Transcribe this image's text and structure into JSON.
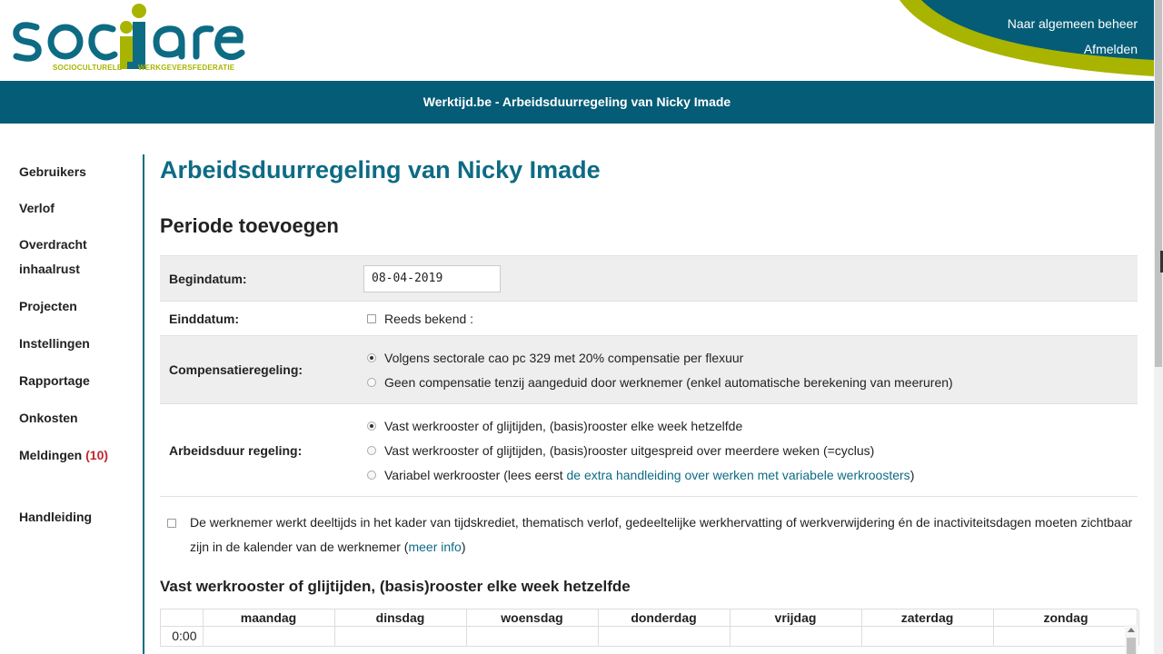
{
  "header": {
    "logo_word": "socmare",
    "logo_tag_left": "SOCIOCULTURELE",
    "logo_tag_right": "WERKGEVERSFEDERATIE",
    "link_admin": "Naar algemeen beheer",
    "link_logout": "Afmelden",
    "band_title": "Werktijd.be - Arbeidsduurregeling van Nicky Imade"
  },
  "sidebar": {
    "items": [
      {
        "label": "Gebruikers"
      },
      {
        "label": "Verlof"
      },
      {
        "label": "Overdracht"
      },
      {
        "label": "inhaalrust"
      },
      {
        "label": "Projecten"
      },
      {
        "label": "Instellingen"
      },
      {
        "label": "Rapportage"
      },
      {
        "label": "Onkosten"
      },
      {
        "label": "Meldingen",
        "count": "(10)"
      },
      {
        "label": "Handleiding"
      }
    ]
  },
  "main": {
    "title": "Arbeidsduurregeling van Nicky Imade",
    "subtitle": "Periode toevoegen",
    "form": {
      "begin_label": "Begindatum:",
      "begin_value": "08-04-2019",
      "end_label": "Einddatum:",
      "end_checkbox": "Reeds bekend :",
      "comp_label": "Compensatieregeling:",
      "comp_options": [
        "Volgens sectorale cao pc 329 met 20% compensatie per flexuur",
        "Geen compensatie tenzij aangeduid door werknemer (enkel automatische berekening van meeruren)"
      ],
      "regime_label": "Arbeidsduur regeling:",
      "regime_options": [
        "Vast werkrooster of glijtijden, (basis)rooster elke week hetzelfde",
        "Vast werkrooster of glijtijden, (basis)rooster uitgespreid over meerdere weken (=cyclus)",
        "Variabel werkrooster (lees eerst "
      ],
      "regime_link": "de extra handleiding over werken met variabele werkroosters",
      "regime_link_suffix": ")"
    },
    "note": {
      "text": "De werknemer werkt deeltijds in het kader van tijdskrediet, thematisch verlof, gedeeltelijke werkhervatting of werkverwijdering én de inactiviteitsdagen moeten zichtbaar zijn in de kalender van de werknemer (",
      "link": "meer info",
      "suffix": ")"
    },
    "section_title": "Vast werkrooster of glijtijden, (basis)rooster elke week hetzelfde",
    "grid": {
      "days": [
        "maandag",
        "dinsdag",
        "woensdag",
        "donderdag",
        "vrijdag",
        "zaterdag",
        "zondag"
      ],
      "first_time": "0:00"
    }
  },
  "colors": {
    "brand": "#055c77",
    "accent": "#a8b400",
    "alert": "#c0272d"
  }
}
